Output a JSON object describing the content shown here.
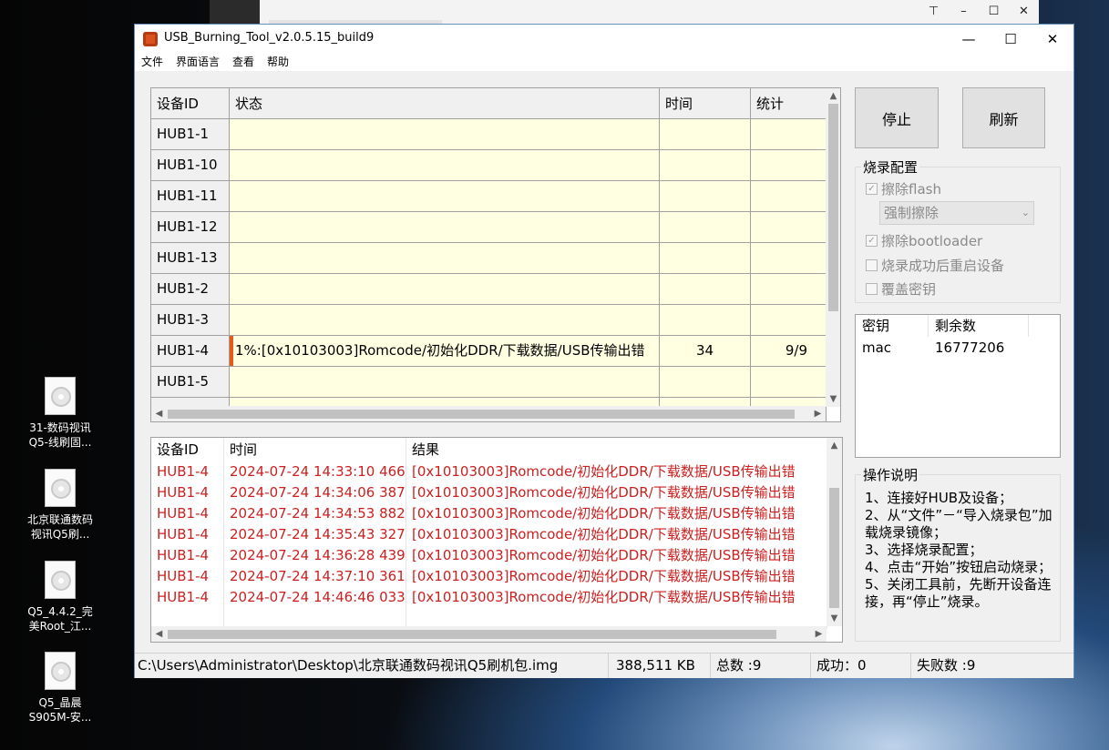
{
  "background_window": {
    "buttons": [
      "⊤",
      "–",
      "☐",
      "✕"
    ]
  },
  "desktop_icons": [
    {
      "line1": "31-数码视讯",
      "line2": "Q5-线刷固..."
    },
    {
      "line1": "北京联通数码",
      "line2": "视讯Q5刷..."
    },
    {
      "line1": "Q5_4.4.2_完",
      "line2": "美Root_江..."
    },
    {
      "line1": "Q5_晶晨",
      "line2": "S905M-安..."
    }
  ],
  "window": {
    "title": "USB_Burning_Tool_v2.0.5.15_build9",
    "controls": {
      "minimize": "—",
      "maximize": "☐",
      "close": "✕"
    }
  },
  "menu": [
    "文件",
    "界面语言",
    "查看",
    "帮助"
  ],
  "device_grid": {
    "headers": {
      "id": "设备ID",
      "status": "状态",
      "time": "时间",
      "count": "统计"
    },
    "rows": [
      {
        "id": "HUB1-1",
        "status": "",
        "time": "",
        "count": ""
      },
      {
        "id": "HUB1-10",
        "status": "",
        "time": "",
        "count": ""
      },
      {
        "id": "HUB1-11",
        "status": "",
        "time": "",
        "count": ""
      },
      {
        "id": "HUB1-12",
        "status": "",
        "time": "",
        "count": ""
      },
      {
        "id": "HUB1-13",
        "status": "",
        "time": "",
        "count": ""
      },
      {
        "id": "HUB1-2",
        "status": "",
        "time": "",
        "count": ""
      },
      {
        "id": "HUB1-3",
        "status": "",
        "time": "",
        "count": ""
      },
      {
        "id": "HUB1-4",
        "status": "1%:[0x10103003]Romcode/初始化DDR/下载数据/USB传输出错",
        "time": "34",
        "count": "9/9"
      },
      {
        "id": "HUB1-5",
        "status": "",
        "time": "",
        "count": ""
      },
      {
        "id": "",
        "status": "",
        "time": "",
        "count": ""
      }
    ]
  },
  "log_grid": {
    "headers": {
      "id": "设备ID",
      "time": "时间",
      "result": "结果"
    },
    "rows": [
      {
        "id": "HUB1-4",
        "time": "2024-07-24 14:33:10 466",
        "result": "[0x10103003]Romcode/初始化DDR/下载数据/USB传输出错"
      },
      {
        "id": "HUB1-4",
        "time": "2024-07-24 14:34:06 387",
        "result": "[0x10103003]Romcode/初始化DDR/下载数据/USB传输出错"
      },
      {
        "id": "HUB1-4",
        "time": "2024-07-24 14:34:53 882",
        "result": "[0x10103003]Romcode/初始化DDR/下载数据/USB传输出错"
      },
      {
        "id": "HUB1-4",
        "time": "2024-07-24 14:35:43 327",
        "result": "[0x10103003]Romcode/初始化DDR/下载数据/USB传输出错"
      },
      {
        "id": "HUB1-4",
        "time": "2024-07-24 14:36:28 439",
        "result": "[0x10103003]Romcode/初始化DDR/下载数据/USB传输出错"
      },
      {
        "id": "HUB1-4",
        "time": "2024-07-24 14:37:10 361",
        "result": "[0x10103003]Romcode/初始化DDR/下载数据/USB传输出错"
      },
      {
        "id": "HUB1-4",
        "time": "2024-07-24 14:46:46 033",
        "result": "[0x10103003]Romcode/初始化DDR/下载数据/USB传输出错"
      }
    ],
    "text_color": "#cc1f1f"
  },
  "buttons": {
    "stop": "停止",
    "refresh": "刷新"
  },
  "burn_config": {
    "title": "烧录配置",
    "erase_flash": {
      "label": "擦除flash",
      "checked": true
    },
    "erase_mode": "强制擦除",
    "erase_bootloader": {
      "label": "擦除bootloader",
      "checked": true
    },
    "reboot_after": {
      "label": "烧录成功后重启设备",
      "checked": false
    },
    "overwrite_key": {
      "label": "覆盖密钥",
      "checked": false
    }
  },
  "key_table": {
    "headers": {
      "key": "密钥",
      "remaining": "剩余数"
    },
    "rows": [
      {
        "key": "mac",
        "remaining": "16777206"
      }
    ]
  },
  "instructions": {
    "title": "操作说明",
    "text": "1、连接好HUB及设备；\n2、从“文件”－“导入烧录包”加载烧录镜像；\n3、选择烧录配置；\n4、点击“开始”按钮启动烧录；\n5、关闭工具前，先断开设备连接，再“停止”烧录。"
  },
  "status_bar": {
    "path": "C:\\Users\\Administrator\\Desktop\\北京联通数码视讯Q5刷机包.img",
    "size": "388,511 KB",
    "total": "总数 :9",
    "success": "成功：0",
    "failed": "失败数 :9"
  },
  "colors": {
    "grid_cell_bg": "#ffffe1",
    "active_marker": "#e85a1a",
    "window_border": "#6b8fb8"
  }
}
